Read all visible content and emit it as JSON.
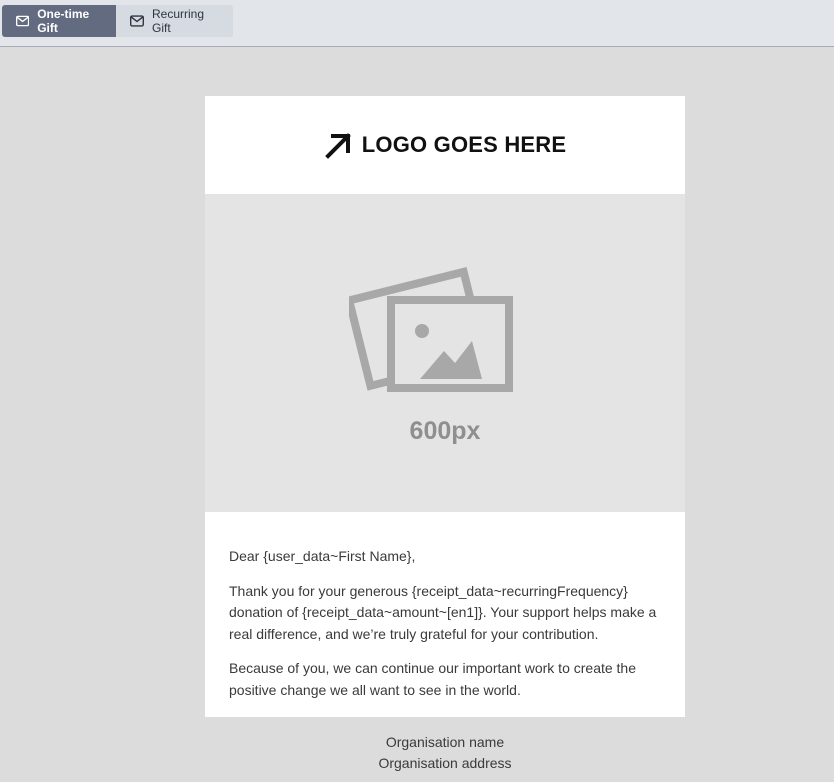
{
  "tabs": [
    {
      "label": "One-time Gift",
      "icon": "mail-icon",
      "active": true
    },
    {
      "label": "Recurring Gift",
      "icon": "mail-icon",
      "active": false
    }
  ],
  "email": {
    "logo_text": "LOGO GOES HERE",
    "logo_icon": "arrow-up-right-icon",
    "hero": {
      "icon": "image-placeholder-icon",
      "label": "600px"
    },
    "paragraphs": [
      "Dear {user_data~First Name},",
      "Thank you for your generous {receipt_data~recurringFrequency} donation of {receipt_data~amount~[en1]}. Your support helps make a real difference, and we’re truly grateful for your contribution.",
      "Because of you, we can continue our important work to create the positive change we all want to see in the world."
    ]
  },
  "footer": {
    "org_name": "Organisation name",
    "org_address": "Organisation address"
  },
  "colors": {
    "tab_active_bg": "#626b80",
    "tab_inactive_bg": "#d6dae1",
    "canvas_bg": "#dcdcdc"
  }
}
